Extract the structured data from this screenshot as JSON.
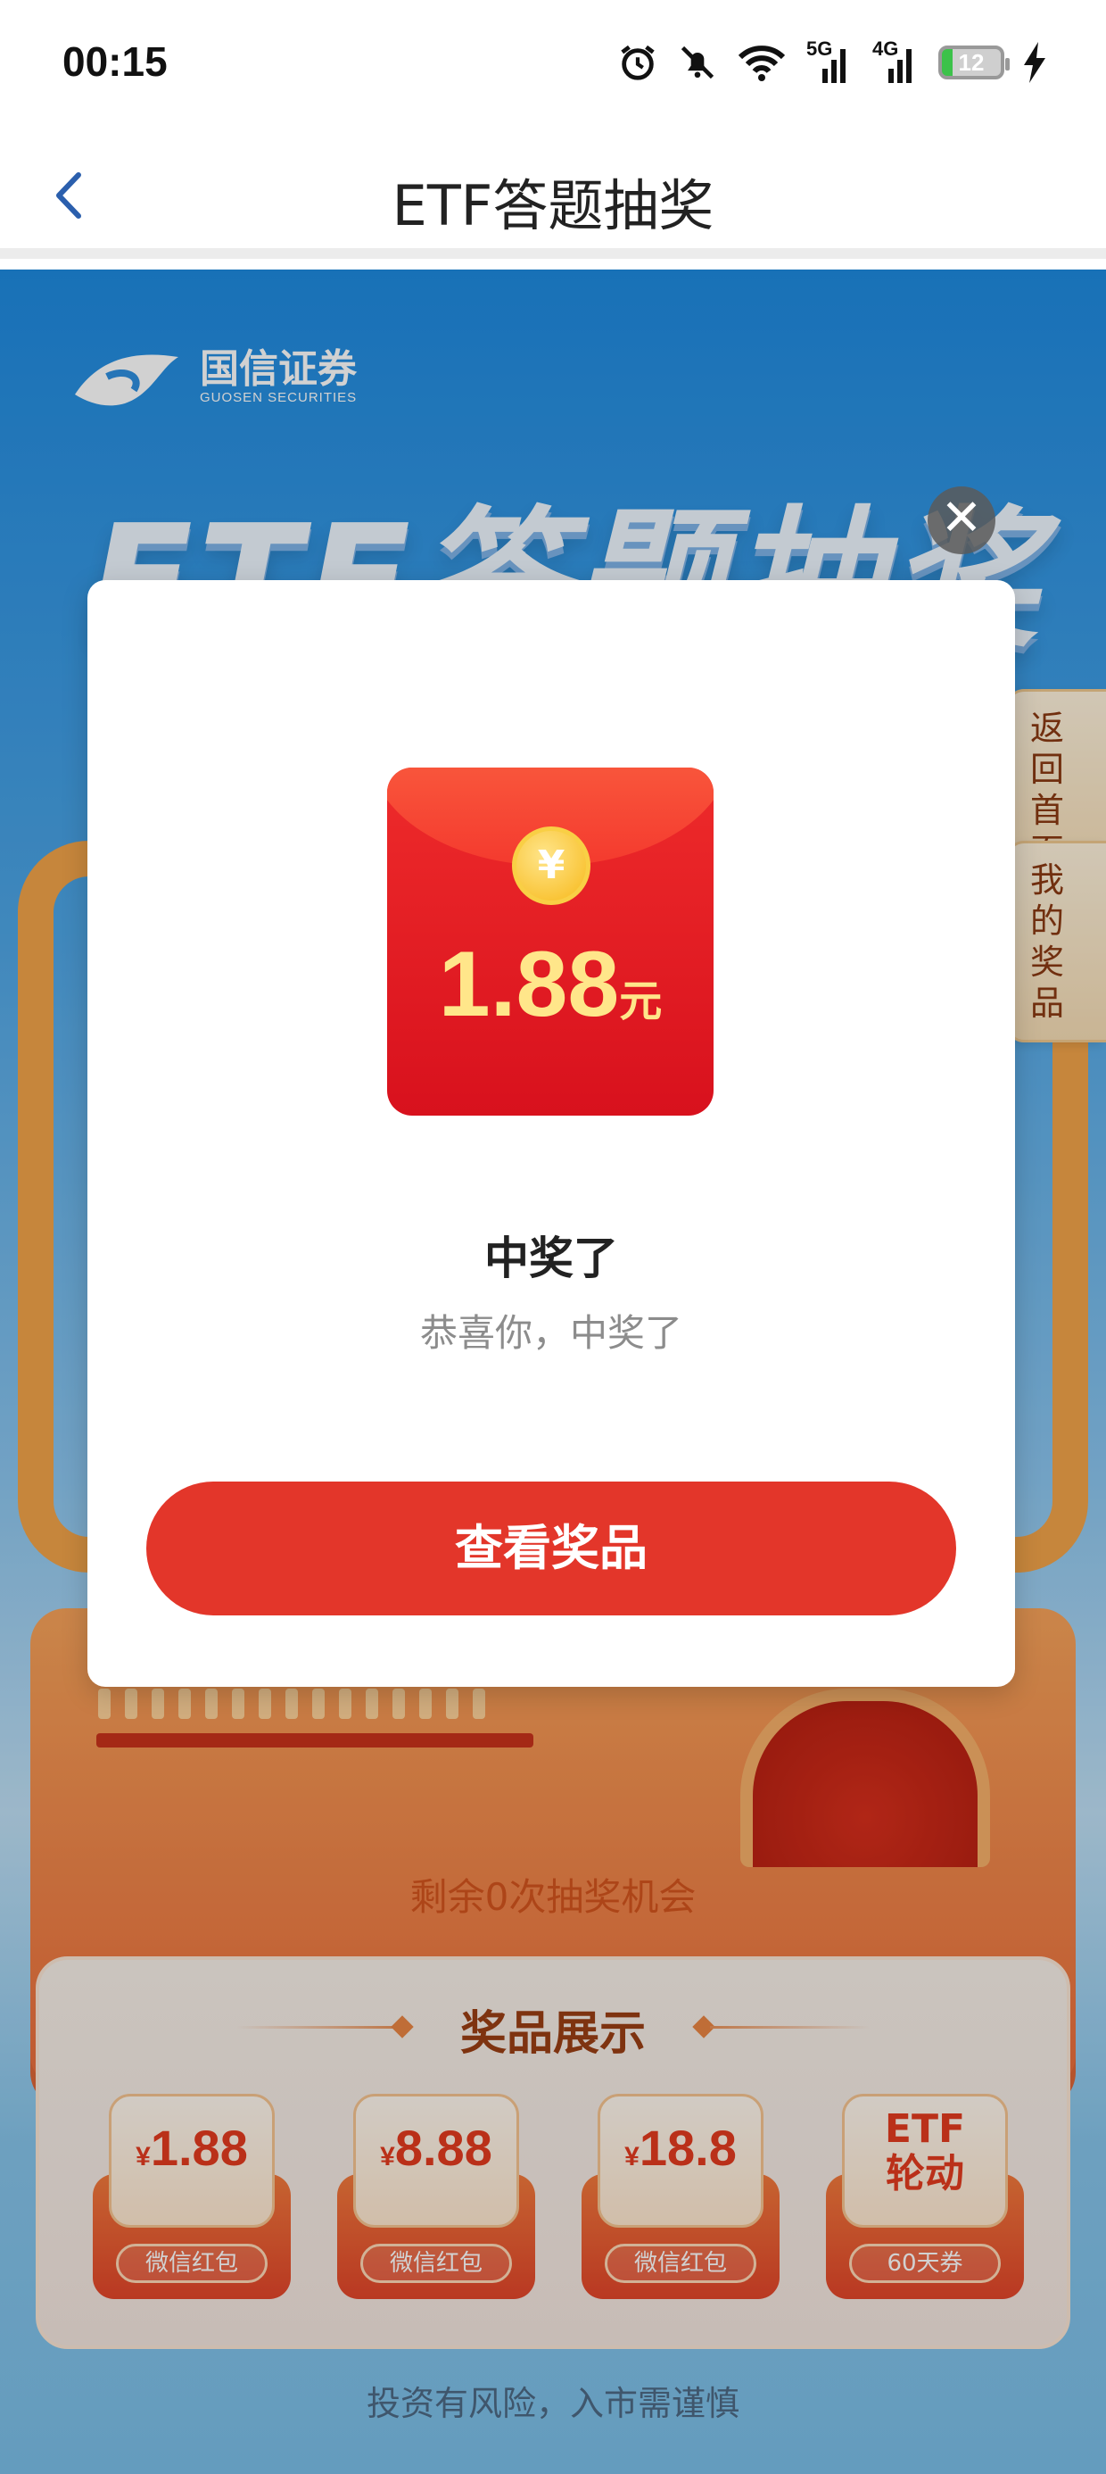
{
  "status_bar": {
    "time": "00:15",
    "network_5g": "5G",
    "network_4g": "4G",
    "battery": "12",
    "icons": [
      "alarm-icon",
      "mute-icon",
      "wifi-icon",
      "signal-5g-icon",
      "signal-4g-icon",
      "battery-icon",
      "charging-icon"
    ]
  },
  "navbar": {
    "title": "ETF答题抽奖",
    "back_icon": "chevron-left-icon"
  },
  "banner": {
    "logo_name": "国信证券",
    "logo_sub": "GUOSEN SECURITIES",
    "title": "ETF答题抽奖"
  },
  "side_tabs": {
    "home_line1": "返回",
    "home_line2": "首页",
    "prizes_line1": "我的",
    "prizes_line2": "奖品"
  },
  "dialog": {
    "close_glyph": "✕",
    "coin_symbol": "¥",
    "amount": "1.88",
    "unit": "元",
    "title": "中奖了",
    "subtitle": "恭喜你，中奖了",
    "button": "查看奖品"
  },
  "remaining": "剩余0次抽奖机会",
  "prize_showcase": {
    "title": "奖品展示",
    "items": [
      {
        "currency": "¥",
        "amount": "1.88",
        "tag": "微信红包"
      },
      {
        "currency": "¥",
        "amount": "8.88",
        "tag": "微信红包"
      },
      {
        "currency": "¥",
        "amount": "18.8",
        "tag": "微信红包"
      },
      {
        "line1": "ETF",
        "line2": "轮动",
        "tag": "60天券"
      }
    ]
  },
  "disclaimer": "投资有风险，入市需谨慎",
  "colors": {
    "primary_red": "#e3362a",
    "accent_orange": "#d4551e",
    "banner_blue": "#1e8ae0"
  }
}
